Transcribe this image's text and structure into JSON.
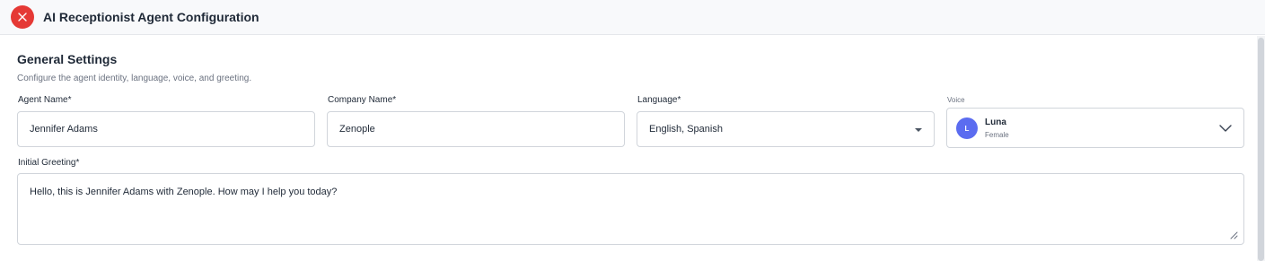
{
  "header": {
    "title": "AI Receptionist Agent Configuration",
    "close_icon": "close-icon",
    "close_color": "#e53935"
  },
  "general_settings": {
    "title": "General Settings",
    "description": "Configure the agent identity, language, voice, and greeting."
  },
  "fields": {
    "agent_name": {
      "label": "Agent Name",
      "required": "*",
      "value": "Jennifer Adams"
    },
    "company_name": {
      "label": "Company Name",
      "required": "*",
      "value": "Zenople"
    },
    "language": {
      "label": "Language",
      "required": "*",
      "value": "English, Spanish",
      "icon": "caret-down-icon"
    },
    "voice": {
      "label": "Voice",
      "avatar_initial": "L",
      "name": "Luna",
      "gender": "Female",
      "avatar_color": "#5b6cf0",
      "icon": "chevron-down-icon"
    },
    "initial_greeting": {
      "label": "Initial Greeting",
      "required": "*",
      "value": "Hello, this is Jennifer Adams with Zenople. How may I help you today?"
    }
  }
}
